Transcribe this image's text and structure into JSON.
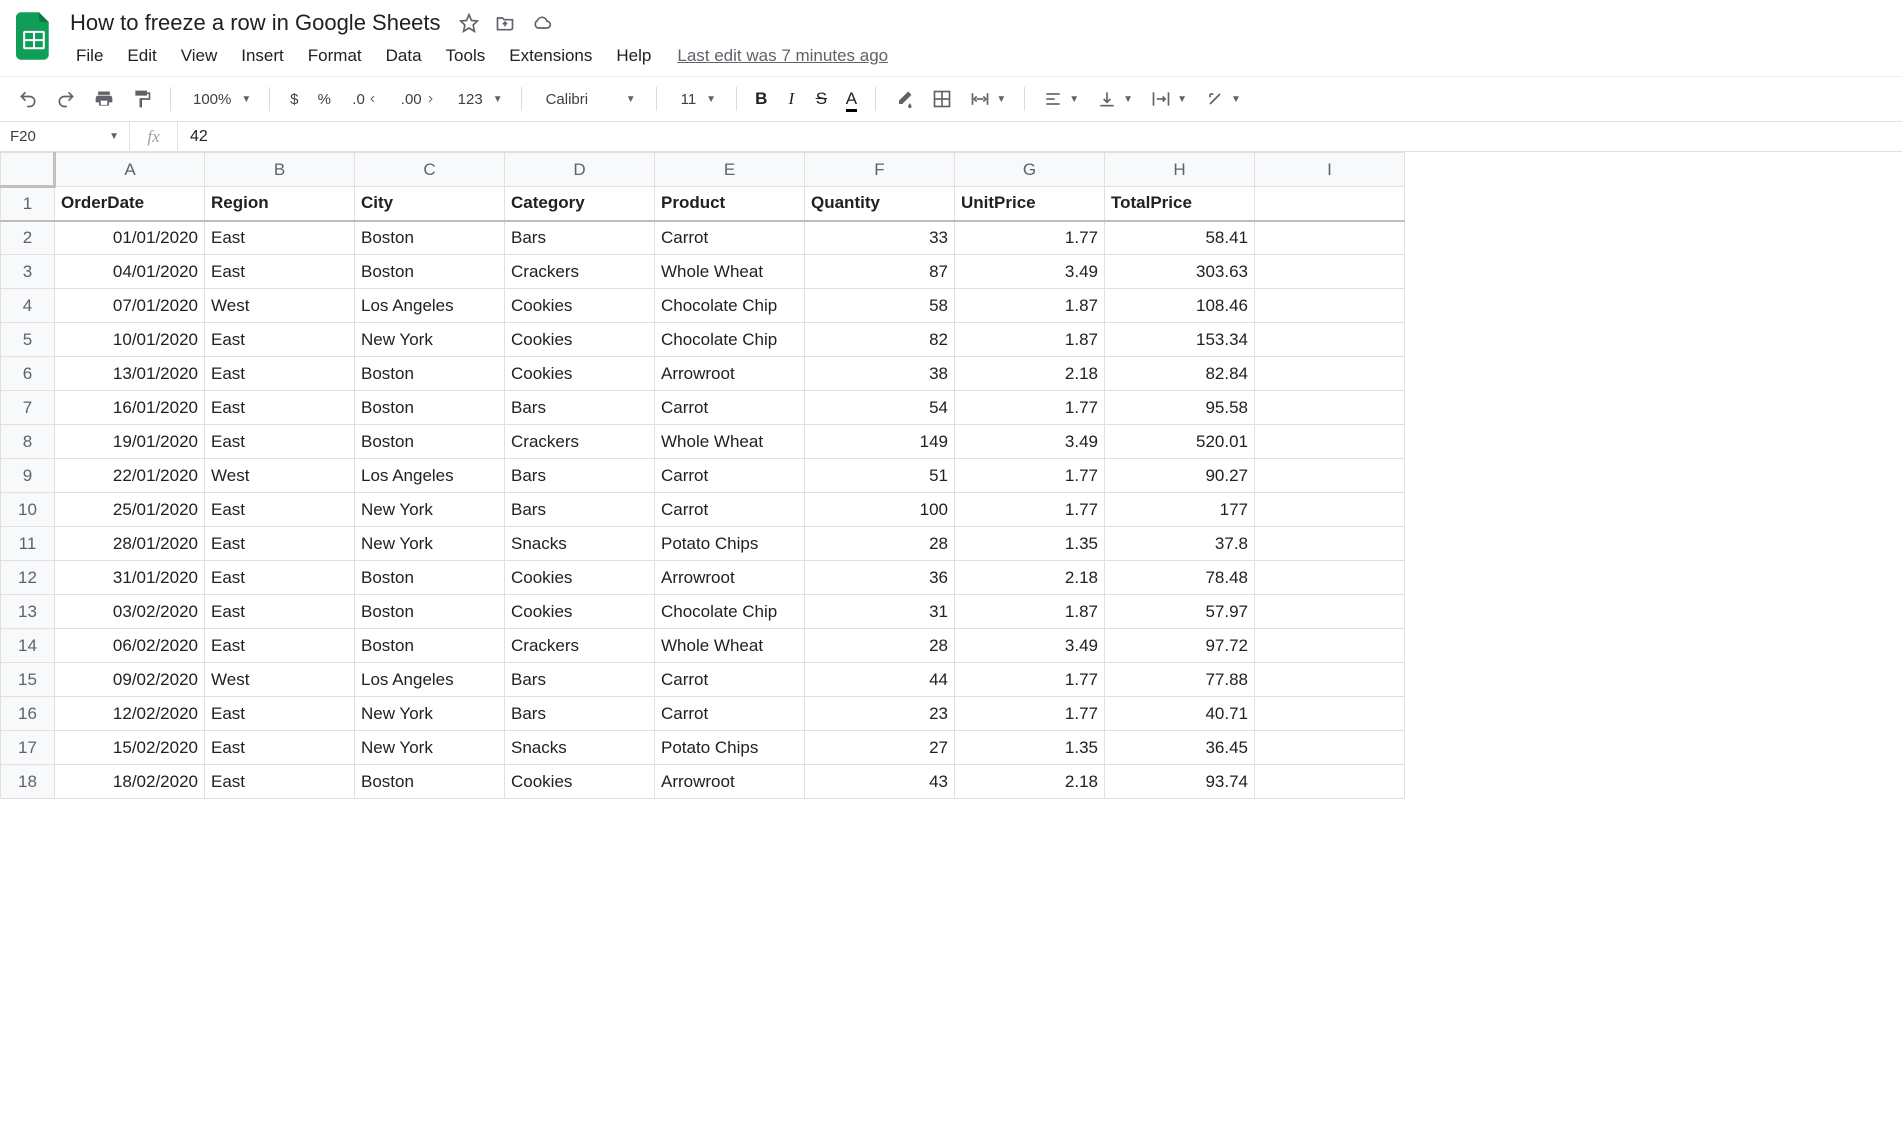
{
  "app": {
    "title": "How to freeze a row in Google Sheets",
    "last_edit": "Last edit was 7 minutes ago"
  },
  "menu": [
    "File",
    "Edit",
    "View",
    "Insert",
    "Format",
    "Data",
    "Tools",
    "Extensions",
    "Help"
  ],
  "toolbar": {
    "zoom": "100%",
    "currency": "$",
    "percent": "%",
    "dec_dec": ".0",
    "dec_inc": ".00",
    "more_formats": "123",
    "font": "Calibri",
    "font_size": "11",
    "bold": "B",
    "italic": "I",
    "strike": "S",
    "text_color": "A"
  },
  "name_box": "F20",
  "fx_label": "fx",
  "fx_value": "42",
  "columns": [
    "A",
    "B",
    "C",
    "D",
    "E",
    "F",
    "G",
    "H",
    "I"
  ],
  "row_count": 18,
  "headers": [
    "OrderDate",
    "Region",
    "City",
    "Category",
    "Product",
    "Quantity",
    "UnitPrice",
    "TotalPrice"
  ],
  "rows": [
    [
      "01/01/2020",
      "East",
      "Boston",
      "Bars",
      "Carrot",
      "33",
      "1.77",
      "58.41"
    ],
    [
      "04/01/2020",
      "East",
      "Boston",
      "Crackers",
      "Whole Wheat",
      "87",
      "3.49",
      "303.63"
    ],
    [
      "07/01/2020",
      "West",
      "Los Angeles",
      "Cookies",
      "Chocolate Chip",
      "58",
      "1.87",
      "108.46"
    ],
    [
      "10/01/2020",
      "East",
      "New York",
      "Cookies",
      "Chocolate Chip",
      "82",
      "1.87",
      "153.34"
    ],
    [
      "13/01/2020",
      "East",
      "Boston",
      "Cookies",
      "Arrowroot",
      "38",
      "2.18",
      "82.84"
    ],
    [
      "16/01/2020",
      "East",
      "Boston",
      "Bars",
      "Carrot",
      "54",
      "1.77",
      "95.58"
    ],
    [
      "19/01/2020",
      "East",
      "Boston",
      "Crackers",
      "Whole Wheat",
      "149",
      "3.49",
      "520.01"
    ],
    [
      "22/01/2020",
      "West",
      "Los Angeles",
      "Bars",
      "Carrot",
      "51",
      "1.77",
      "90.27"
    ],
    [
      "25/01/2020",
      "East",
      "New York",
      "Bars",
      "Carrot",
      "100",
      "1.77",
      "177"
    ],
    [
      "28/01/2020",
      "East",
      "New York",
      "Snacks",
      "Potato Chips",
      "28",
      "1.35",
      "37.8"
    ],
    [
      "31/01/2020",
      "East",
      "Boston",
      "Cookies",
      "Arrowroot",
      "36",
      "2.18",
      "78.48"
    ],
    [
      "03/02/2020",
      "East",
      "Boston",
      "Cookies",
      "Chocolate Chip",
      "31",
      "1.87",
      "57.97"
    ],
    [
      "06/02/2020",
      "East",
      "Boston",
      "Crackers",
      "Whole Wheat",
      "28",
      "3.49",
      "97.72"
    ],
    [
      "09/02/2020",
      "West",
      "Los Angeles",
      "Bars",
      "Carrot",
      "44",
      "1.77",
      "77.88"
    ],
    [
      "12/02/2020",
      "East",
      "New York",
      "Bars",
      "Carrot",
      "23",
      "1.77",
      "40.71"
    ],
    [
      "15/02/2020",
      "East",
      "New York",
      "Snacks",
      "Potato Chips",
      "27",
      "1.35",
      "36.45"
    ],
    [
      "18/02/2020",
      "East",
      "Boston",
      "Cookies",
      "Arrowroot",
      "43",
      "2.18",
      "93.74"
    ]
  ]
}
